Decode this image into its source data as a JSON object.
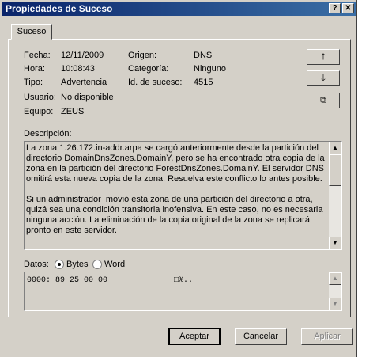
{
  "window": {
    "title": "Propiedades de Suceso",
    "help_label": "?",
    "close_label": "✕"
  },
  "tab": {
    "label": "Suceso"
  },
  "fields": {
    "fecha_label": "Fecha:",
    "fecha_value": "12/11/2009",
    "hora_label": "Hora:",
    "hora_value": "10:08:43",
    "tipo_label": "Tipo:",
    "tipo_value": "Advertencia",
    "usuario_label": "Usuario:",
    "usuario_value": "No disponible",
    "equipo_label": "Equipo:",
    "equipo_value": "ZEUS",
    "origen_label": "Origen:",
    "origen_value": "DNS",
    "categoria_label": "Categoría:",
    "categoria_value": "Ninguno",
    "id_label": "Id. de suceso:",
    "id_value": "4515"
  },
  "side_buttons": {
    "up": "🡑",
    "down": "🡓",
    "copy": "⧉"
  },
  "description": {
    "label": "Descripción:",
    "text": "La zona 1.26.172.in-addr.arpa se cargó anteriormente desde la partición del directorio DomainDnsZones.DomainY, pero se ha encontrado otra copia de la zona en la partición del directorio ForestDnsZones.DomainY. El servidor DNS omitirá esta nueva copia de la zona. Resuelva este conflicto lo antes posible.\n\nSi un administrador  movió esta zona de una partición del directorio a otra, quizá sea una condición transitoria inofensiva. En este caso, no es necesaria ninguna acción. La eliminación de la copia original de la zona se replicará pronto en este servidor."
  },
  "data": {
    "label": "Datos:",
    "bytes_label": "Bytes",
    "word_label": "Word",
    "selected": "Bytes",
    "content": "0000: 89 25 00 00              □%.."
  },
  "buttons": {
    "ok": "Aceptar",
    "cancel": "Cancelar",
    "apply": "Aplicar"
  }
}
